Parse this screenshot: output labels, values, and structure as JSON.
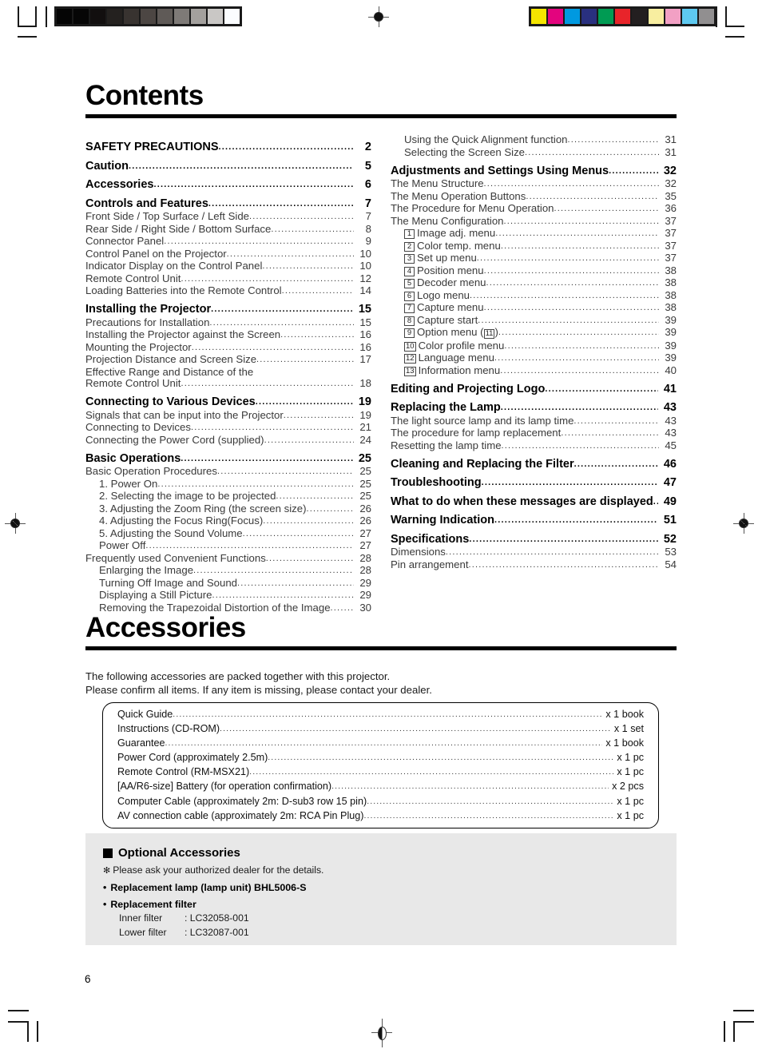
{
  "document": {
    "page_number": "6"
  },
  "print_marks": {
    "grayscale_wedge": [
      "#050505",
      "#060606",
      "#120f0f",
      "#24211f",
      "#383330",
      "#4c4643",
      "#5f5a57",
      "#7e7a77",
      "#a3a09d",
      "#c9c7c5",
      "#fbfdff"
    ],
    "color_bar": [
      "#f5e500",
      "#e3047e",
      "#0099e0",
      "#29307f",
      "#009b53",
      "#e8242a",
      "#231f20",
      "#f8eea0",
      "#f2a0c4",
      "#5ec9f0",
      "#918f90"
    ]
  },
  "contents": {
    "title": "Contents",
    "left_column": [
      {
        "level": 1,
        "label": "SAFETY PRECAUTIONS",
        "page": "2"
      },
      {
        "level": 1,
        "label": "Caution",
        "page": "5"
      },
      {
        "level": 1,
        "label": "Accessories",
        "page": "6"
      },
      {
        "level": 1,
        "label": "Controls and Features",
        "page": "7"
      },
      {
        "level": 2,
        "label": "Front Side / Top Surface / Left Side",
        "page": "7"
      },
      {
        "level": 2,
        "label": "Rear Side / Right Side / Bottom Surface",
        "page": "8"
      },
      {
        "level": 2,
        "label": "Connector Panel",
        "page": "9"
      },
      {
        "level": 2,
        "label": "Control Panel on the Projector",
        "page": "10"
      },
      {
        "level": 2,
        "label": "Indicator Display on the Control Panel",
        "page": "10"
      },
      {
        "level": 2,
        "label": "Remote Control Unit",
        "page": "12"
      },
      {
        "level": 2,
        "label": "Loading Batteries into the Remote Control",
        "page": "14"
      },
      {
        "level": 1,
        "label": "Installing the Projector",
        "page": "15"
      },
      {
        "level": 2,
        "label": "Precautions for Installation",
        "page": "15"
      },
      {
        "level": 2,
        "label": "Installing the Projector against the Screen",
        "page": "16"
      },
      {
        "level": 2,
        "label": "Mounting the Projector",
        "page": "16"
      },
      {
        "level": 2,
        "label": "Projection Distance and Screen Size",
        "page": "17"
      },
      {
        "level": 2,
        "label": "Effective Range and Distance of the",
        "page": "",
        "noleader": true
      },
      {
        "level": 2,
        "label": "Remote Control Unit",
        "page": "18"
      },
      {
        "level": 1,
        "label": "Connecting to Various Devices",
        "page": "19"
      },
      {
        "level": 2,
        "label": "Signals that can be input into the Projector",
        "page": "19"
      },
      {
        "level": 2,
        "label": "Connecting to Devices",
        "page": "21"
      },
      {
        "level": 2,
        "label": "Connecting the Power Cord (supplied)",
        "page": "24"
      },
      {
        "level": 1,
        "label": "Basic Operations",
        "page": "25"
      },
      {
        "level": 2,
        "label": "Basic Operation Procedures",
        "page": "25"
      },
      {
        "level": 3,
        "label": "1. Power On",
        "page": "25"
      },
      {
        "level": 3,
        "label": "2. Selecting the image to be projected",
        "page": "25"
      },
      {
        "level": 3,
        "label": "3. Adjusting the Zoom Ring (the screen size)",
        "page": "26"
      },
      {
        "level": 3,
        "label": "4. Adjusting the Focus Ring(Focus)",
        "page": "26"
      },
      {
        "level": 3,
        "label": "5. Adjusting the Sound Volume",
        "page": "27"
      },
      {
        "level": 3,
        "label": "Power Off",
        "page": "27"
      },
      {
        "level": 2,
        "label": "Frequently used Convenient Functions",
        "page": "28"
      },
      {
        "level": 3,
        "label": "Enlarging the Image",
        "page": "28"
      },
      {
        "level": 3,
        "label": "Turning Off Image and Sound",
        "page": "29"
      },
      {
        "level": 3,
        "label": "Displaying a Still Picture",
        "page": "29"
      },
      {
        "level": 3,
        "label": "Removing the Trapezoidal Distortion of the Image",
        "page": "30"
      }
    ],
    "right_column": [
      {
        "level": 3,
        "label": "Using the Quick Alignment function",
        "page": "31"
      },
      {
        "level": 3,
        "label": "Selecting the Screen Size",
        "page": "31"
      },
      {
        "level": 1,
        "label": "Adjustments and Settings Using Menus",
        "page": "32"
      },
      {
        "level": 2,
        "label": "The Menu Structure",
        "page": "32"
      },
      {
        "level": 2,
        "label": "The Menu Operation Buttons",
        "page": "35"
      },
      {
        "level": 2,
        "label": "The Procedure for Menu Operation",
        "page": "36"
      },
      {
        "level": 2,
        "label": "The Menu Configuration",
        "page": "37"
      },
      {
        "level": 3,
        "boxnum": "1",
        "label": "Image adj. menu",
        "page": "37"
      },
      {
        "level": 3,
        "boxnum": "2",
        "label": "Color temp. menu",
        "page": "37"
      },
      {
        "level": 3,
        "boxnum": "3",
        "label": "Set up menu",
        "page": "37"
      },
      {
        "level": 3,
        "boxnum": "4",
        "label": "Position menu",
        "page": "38"
      },
      {
        "level": 3,
        "boxnum": "5",
        "label": "Decoder menu",
        "page": "38"
      },
      {
        "level": 3,
        "boxnum": "6",
        "label": "Logo menu",
        "page": "38"
      },
      {
        "level": 3,
        "boxnum": "7",
        "label": "Capture menu",
        "page": "38"
      },
      {
        "level": 3,
        "boxnum": "8",
        "label": "Capture start",
        "page": "39"
      },
      {
        "level": 3,
        "boxnum": "9",
        "label": "Option menu (",
        "label_after": ")",
        "inline_boxnum": "11",
        "page": "39"
      },
      {
        "level": 3,
        "boxnum": "10",
        "label": "Color profile menu",
        "page": "39"
      },
      {
        "level": 3,
        "boxnum": "12",
        "label": "Language menu",
        "page": "39"
      },
      {
        "level": 3,
        "boxnum": "13",
        "label": "Information menu",
        "page": "40"
      },
      {
        "level": 1,
        "label": "Editing and Projecting Logo",
        "page": "41"
      },
      {
        "level": 1,
        "label": "Replacing the Lamp",
        "page": "43"
      },
      {
        "level": 2,
        "label": "The light source lamp and its lamp time",
        "page": "43"
      },
      {
        "level": 2,
        "label": "The procedure for lamp replacement",
        "page": "43"
      },
      {
        "level": 2,
        "label": "Resetting the lamp time",
        "page": "45"
      },
      {
        "level": 1,
        "label": "Cleaning and Replacing the Filter",
        "page": "46"
      },
      {
        "level": 1,
        "label": "Troubleshooting",
        "page": "47"
      },
      {
        "level": 1,
        "label": "What to do when these messages are displayed",
        "page": "49"
      },
      {
        "level": 1,
        "label": "Warning Indication",
        "page": "51"
      },
      {
        "level": 1,
        "label": "Specifications",
        "page": "52"
      },
      {
        "level": 2,
        "label": "Dimensions",
        "page": "53"
      },
      {
        "level": 2,
        "label": "Pin arrangement",
        "page": "54"
      }
    ]
  },
  "accessories": {
    "title": "Accessories",
    "intro_line_1": "The following accessories are packed together with this projector.",
    "intro_line_2": "Please confirm all items. If any item is missing, please contact your dealer.",
    "items": [
      {
        "name": "Quick Guide",
        "qty": "x 1 book"
      },
      {
        "name": "Instructions (CD-ROM)",
        "qty": "x 1 set"
      },
      {
        "name": "Guarantee",
        "qty": "x 1 book"
      },
      {
        "name": "Power Cord (approximately 2.5m)",
        "qty": "x 1 pc"
      },
      {
        "name": "Remote Control (RM-MSX21)",
        "qty": "x 1 pc"
      },
      {
        "name": "[AA/R6-size] Battery (for operation confirmation)",
        "qty": "x 2 pcs"
      },
      {
        "name": "Computer Cable (approximately 2m: D-sub3 row 15 pin)",
        "qty": "x 1 pc"
      },
      {
        "name": "AV connection cable (approximately 2m: RCA Pin Plug)",
        "qty": "x 1 pc"
      }
    ]
  },
  "optional_accessories": {
    "title": "Optional Accessories",
    "note": "Please ask your authorized dealer for the details.",
    "note_symbol": "✻",
    "bullet_lamp": "Replacement lamp (lamp unit)  BHL5006-S",
    "bullet_filter": "Replacement filter",
    "filters": [
      {
        "name": "Inner filter",
        "code": ": LC32058-001"
      },
      {
        "name": "Lower filter",
        "code": ": LC32087-001"
      }
    ]
  }
}
